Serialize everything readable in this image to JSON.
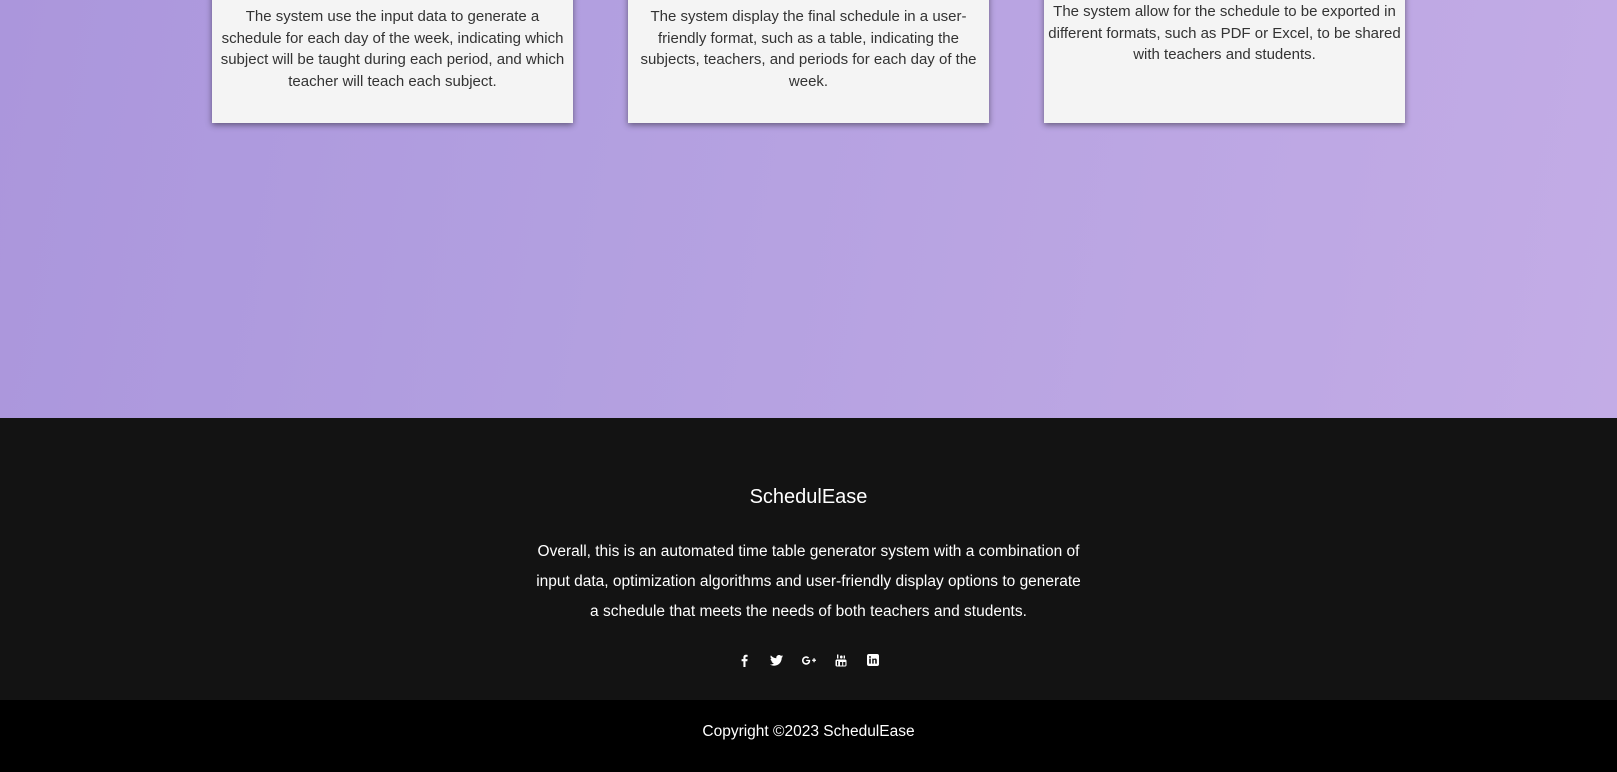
{
  "features": [
    {
      "text": "The system use the input data to generate a schedule for each day of the week, indicating which subject will be taught during each period, and which teacher will teach each subject."
    },
    {
      "text": "The system display the final schedule in a user-friendly format, such as a table, indicating the subjects, teachers, and periods for each day of the week."
    },
    {
      "text": "The system allow for the schedule to be exported in different formats, such as PDF or Excel, to be shared with teachers and students."
    }
  ],
  "footer": {
    "brand": "SchedulEase",
    "about": "Overall, this is an automated time table generator system with a combination of input data, optimization algorithms and user-friendly display options to generate a schedule that meets the needs of both teachers and students.",
    "social": [
      {
        "icon": "facebook-icon",
        "glyph": "f"
      },
      {
        "icon": "twitter-icon",
        "glyph": "🐦"
      },
      {
        "icon": "google-plus-icon",
        "glyph": "G+"
      },
      {
        "icon": "youtube-icon",
        "glyph": "▶"
      },
      {
        "icon": "linkedin-icon",
        "glyph": "in"
      }
    ],
    "copyright": "Copyright ©2023  SchedulEase"
  },
  "colors": {
    "hero_background": "#b29fe0",
    "card_background": "#f4f4f4",
    "footer_background": "#131313",
    "copyright_background": "#000000"
  }
}
